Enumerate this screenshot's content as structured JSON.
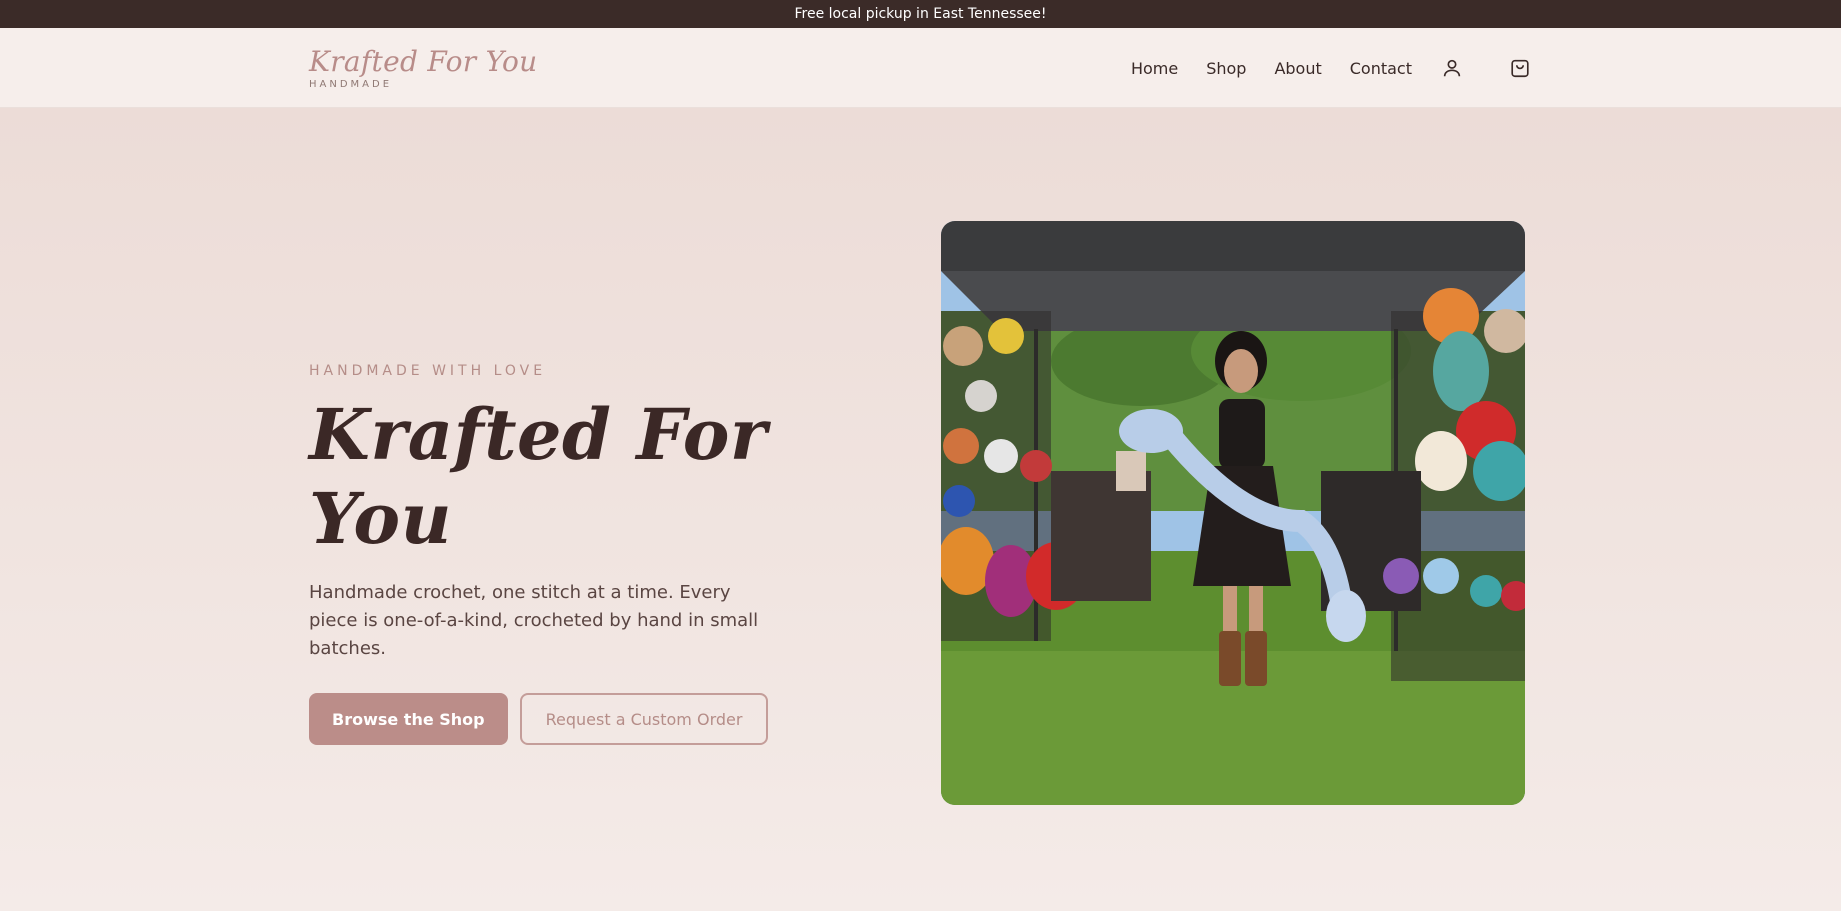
{
  "announcement": "Free local pickup in East Tennessee!",
  "header": {
    "logo_script": "Krafted For You",
    "logo_sub": "HANDMADE",
    "nav": [
      "Home",
      "Shop",
      "About",
      "Contact"
    ],
    "icons": [
      "user-icon",
      "shopping-bag-icon"
    ]
  },
  "hero": {
    "eyebrow": "HANDMADE WITH LOVE",
    "title": "Krafted For You",
    "description": "Handmade crochet, one stitch at a time. Every piece is one-of-a-kind, crocheted by hand in small batches.",
    "primary_button": "Browse the Shop",
    "secondary_button": "Request a Custom Order"
  },
  "colors": {
    "topbar": "#3b2b28",
    "accent": "#bb8d89",
    "text_dark": "#3a2a28"
  }
}
